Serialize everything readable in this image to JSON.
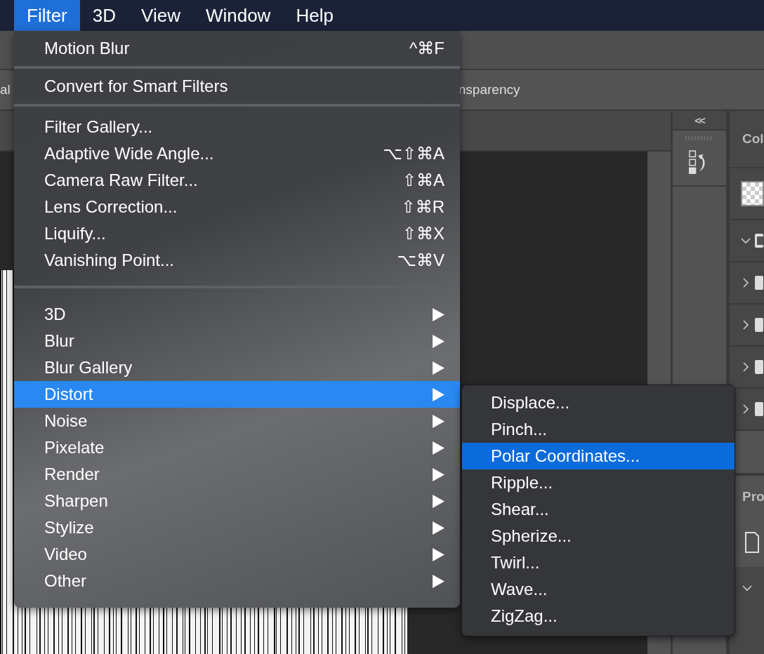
{
  "menubar": [
    {
      "label": "Filter",
      "selected": true
    },
    {
      "label": "3D",
      "selected": false
    },
    {
      "label": "View",
      "selected": false
    },
    {
      "label": "Window",
      "selected": false
    },
    {
      "label": "Help",
      "selected": false
    }
  ],
  "options_bar": {
    "left_fragment": "al",
    "right_fragment": "nsparency"
  },
  "panels": {
    "collapse": "<<",
    "top_fragment": "Col",
    "bottom_fragment": "Pro",
    "layer_rows": [
      {
        "expanded": true
      },
      {
        "expanded": false
      },
      {
        "expanded": false
      },
      {
        "expanded": false
      },
      {
        "expanded": false
      }
    ]
  },
  "filter_menu": {
    "sections": [
      {
        "kind": "top",
        "items": [
          {
            "label": "Motion Blur",
            "shortcut": "^⌘F",
            "submenu": false,
            "selected": false
          }
        ]
      },
      {
        "kind": "top",
        "items": [
          {
            "label": "Convert for Smart Filters",
            "submenu": false,
            "selected": false
          }
        ]
      },
      {
        "kind": "plain",
        "items": [
          {
            "label": "Filter Gallery...",
            "submenu": false,
            "selected": false
          },
          {
            "label": "Adaptive Wide Angle...",
            "shortcut": "⌥⇧⌘A",
            "submenu": false,
            "selected": false
          },
          {
            "label": "Camera Raw Filter...",
            "shortcut": "⇧⌘A",
            "submenu": false,
            "selected": false
          },
          {
            "label": "Lens Correction...",
            "shortcut": "⇧⌘R",
            "submenu": false,
            "selected": false
          },
          {
            "label": "Liquify...",
            "shortcut": "⇧⌘X",
            "submenu": false,
            "selected": false
          },
          {
            "label": "Vanishing Point...",
            "shortcut": "⌥⌘V",
            "submenu": false,
            "selected": false
          }
        ]
      },
      {
        "kind": "plain",
        "items": [
          {
            "label": "3D",
            "submenu": true,
            "selected": false
          },
          {
            "label": "Blur",
            "submenu": true,
            "selected": false
          },
          {
            "label": "Blur Gallery",
            "submenu": true,
            "selected": false
          },
          {
            "label": "Distort",
            "submenu": true,
            "selected": true
          },
          {
            "label": "Noise",
            "submenu": true,
            "selected": false
          },
          {
            "label": "Pixelate",
            "submenu": true,
            "selected": false
          },
          {
            "label": "Render",
            "submenu": true,
            "selected": false
          },
          {
            "label": "Sharpen",
            "submenu": true,
            "selected": false
          },
          {
            "label": "Stylize",
            "submenu": true,
            "selected": false
          },
          {
            "label": "Video",
            "submenu": true,
            "selected": false
          },
          {
            "label": "Other",
            "submenu": true,
            "selected": false
          }
        ]
      }
    ]
  },
  "distort_submenu": {
    "items": [
      {
        "label": "Displace...",
        "selected": false
      },
      {
        "label": "Pinch...",
        "selected": false
      },
      {
        "label": "Polar Coordinates...",
        "selected": true
      },
      {
        "label": "Ripple...",
        "selected": false
      },
      {
        "label": "Shear...",
        "selected": false
      },
      {
        "label": "Spherize...",
        "selected": false
      },
      {
        "label": "Twirl...",
        "selected": false
      },
      {
        "label": "Wave...",
        "selected": false
      },
      {
        "label": "ZigZag...",
        "selected": false
      }
    ]
  }
}
